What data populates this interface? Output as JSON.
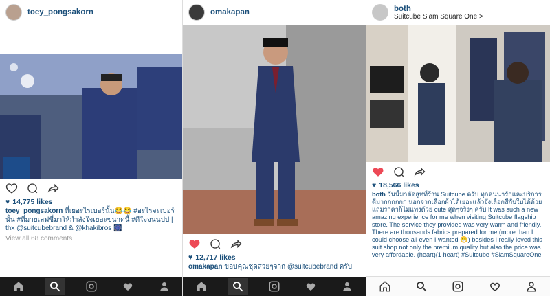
{
  "posts": [
    {
      "username": "toey_pongsakorn",
      "likes": "14,775 likes",
      "caption_user": "toey_pongsakorn",
      "caption_text": "ที่เยอะไรเบอร์นั้น😂😂 #อะไรจะเบอร์นั้น #ที่มายเลฟซี่มาให้กำลังใจเยอะขนาดนี้ #ดีใจจนนปป | thx @suitcubebrand & @khakibros 🎆",
      "view_all": "View all 68 comments"
    },
    {
      "username": "omakapan",
      "likes": "12,717 likes",
      "caption_user": "omakapan",
      "caption_text": "ขอบคุณชุดสวยๆจาก @suitcubebrand ครับ"
    },
    {
      "username": "both",
      "location": "Suitcube Siam Square One >",
      "likes": "18,566 likes",
      "caption_user": "both",
      "caption_text": "วันนี้มาตัดสูทที่ร้าน Suitcube ครับ ทุกคนน่ารักและบริการดีมากกกกกก นอกจากเลือกผ้าได้เยอะแล้วยังเลือกสีกับใบได้ด้วย แถมราคาก็ไม่แพงด้วย cute สุดๆจริงๆ ครับ It was such a new amazing experience for me when visiting Suitcube flagship store. The service they provided was very warm and friendly. There are thousands fabrics prepared for me (more than I could choose all even I wanted 😁) besides I really loved this suit shop not only the premium quality but also the price was very affordable. (heart)(1 heart) #Suitcube #SiamSquareOne"
    }
  ],
  "icons": {
    "heart": "heart-icon",
    "comment": "comment-icon",
    "share": "share-icon",
    "home": "home-icon",
    "search": "search-icon",
    "camera": "camera-icon",
    "activity": "activity-icon",
    "profile": "profile-icon"
  },
  "colors": {
    "liked_heart": "#ed4956",
    "link_blue": "#1b4f7a",
    "dark_tabbar": "#1a1a1a"
  }
}
